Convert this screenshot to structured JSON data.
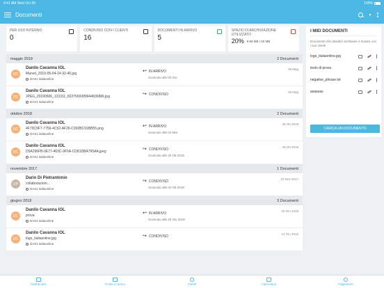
{
  "statusbar": {
    "time": "9:41 AM",
    "date": "Wed Oct 30",
    "battery": "100%"
  },
  "header": {
    "title": "Documenti"
  },
  "stats": [
    {
      "label": "PER USO INTERNO",
      "value": "0"
    },
    {
      "label": "CONDIVISO CON I CLIENTI",
      "value": "16"
    },
    {
      "label": "DOCUMENTI IN ARRIVO",
      "value": "5"
    },
    {
      "label": "SPAZIO DI ARCHIVIAZIONE UTILIZZATO",
      "value": "20%",
      "detail": "9.88 MB / 50 MB"
    }
  ],
  "groups": [
    {
      "title": "maggio 2019",
      "count": "2 Documenti",
      "docs": [
        {
          "initials": "DC",
          "sender": "Danilo Cavanna IOL",
          "file": "Marvel_2019-05-04-14-32-46.jpg",
          "org": "DAS1 italiaonline",
          "direction": "IN ARRIVO",
          "arrow": "↩",
          "sub": "Scaricato alle 03 Giu",
          "date": "06 Mag"
        },
        {
          "initials": "DC",
          "sender": "Danilo Cavanna IOL",
          "file": "JPEG_20190506_123311_8227669389944600886.jpg",
          "org": "DAS1 italiaonline",
          "direction": "CONDIVISO",
          "arrow": "↪",
          "sub": "",
          "date": "06 Mag"
        }
      ]
    },
    {
      "title": "ottobre 2018",
      "count": "2 Documenti",
      "docs": [
        {
          "initials": "DC",
          "sender": "Danilo Cavanna IOL",
          "file": "4F73C9F7-7756-4C52-AF26-C092BC91BB55.png",
          "org": "DAS1 italiaonline",
          "direction": "IN ARRIVO",
          "arrow": "↩",
          "sub": "Scaricato alle 04 Mar",
          "date": "25 Ott 2018"
        },
        {
          "initials": "DC",
          "sender": "Danilo Cavanna IOL",
          "file": "D5A296FB-0E77-463C-9F5A-CD81DBA795AA.jpeg",
          "org": "DAS1 italiaonline",
          "direction": "CONDIVISO",
          "arrow": "↪",
          "sub": "Scaricato alle 25 Ott 2018",
          "date": "25 Ott 2018"
        }
      ]
    },
    {
      "title": "novembre 2017",
      "count": "1 Documenti",
      "docs": [
        {
          "initials": "DP",
          "photo": true,
          "sender": "Dario Di Pietrantonio",
          "file": "collaborazioni...",
          "org": "DAS1 italiaonline",
          "direction": "CONDIVISO",
          "arrow": "↪",
          "sub": "Scaricato alle 04 Ott 2018",
          "date": "10 Nov 2017"
        }
      ]
    },
    {
      "title": "giugno 2018",
      "count": "3 Documenti",
      "docs": [
        {
          "initials": "DC",
          "sender": "Danilo Cavanna IOL",
          "file": "prova",
          "org": "DAS1 italiaonline",
          "direction": "IN ARRIVO",
          "arrow": "↩",
          "sub": "Scaricato alle 25 Giu 2018",
          "date": "25 Giu 2018"
        },
        {
          "initials": "DC",
          "sender": "Danilo Cavanna IOL",
          "file": "logo_italiaonline.jpg",
          "org": "DAS1 italiaonline",
          "direction": "CONDIVISO",
          "arrow": "↪",
          "sub": "",
          "date": "13 Giu 2018"
        }
      ]
    }
  ],
  "side": {
    "title": "I MIEI DOCUMENTI",
    "description": "Documenti che desideri archiviare e riusare con i tuoi clienti",
    "docs": [
      "logo_italiaonline.jpg",
      "testo di prova",
      "negative_phrase.txt",
      "asaasas"
    ],
    "upload_label": "CARICA UN DOCUMENTO"
  },
  "tabs": [
    "Dashboard",
    "Posta in arrivo",
    "Clienti",
    "Calendario",
    "Pagamenti"
  ],
  "colors": {
    "accent": "#4cb7e3",
    "avatar": "#f3b27b",
    "background": "#eef1f4"
  }
}
